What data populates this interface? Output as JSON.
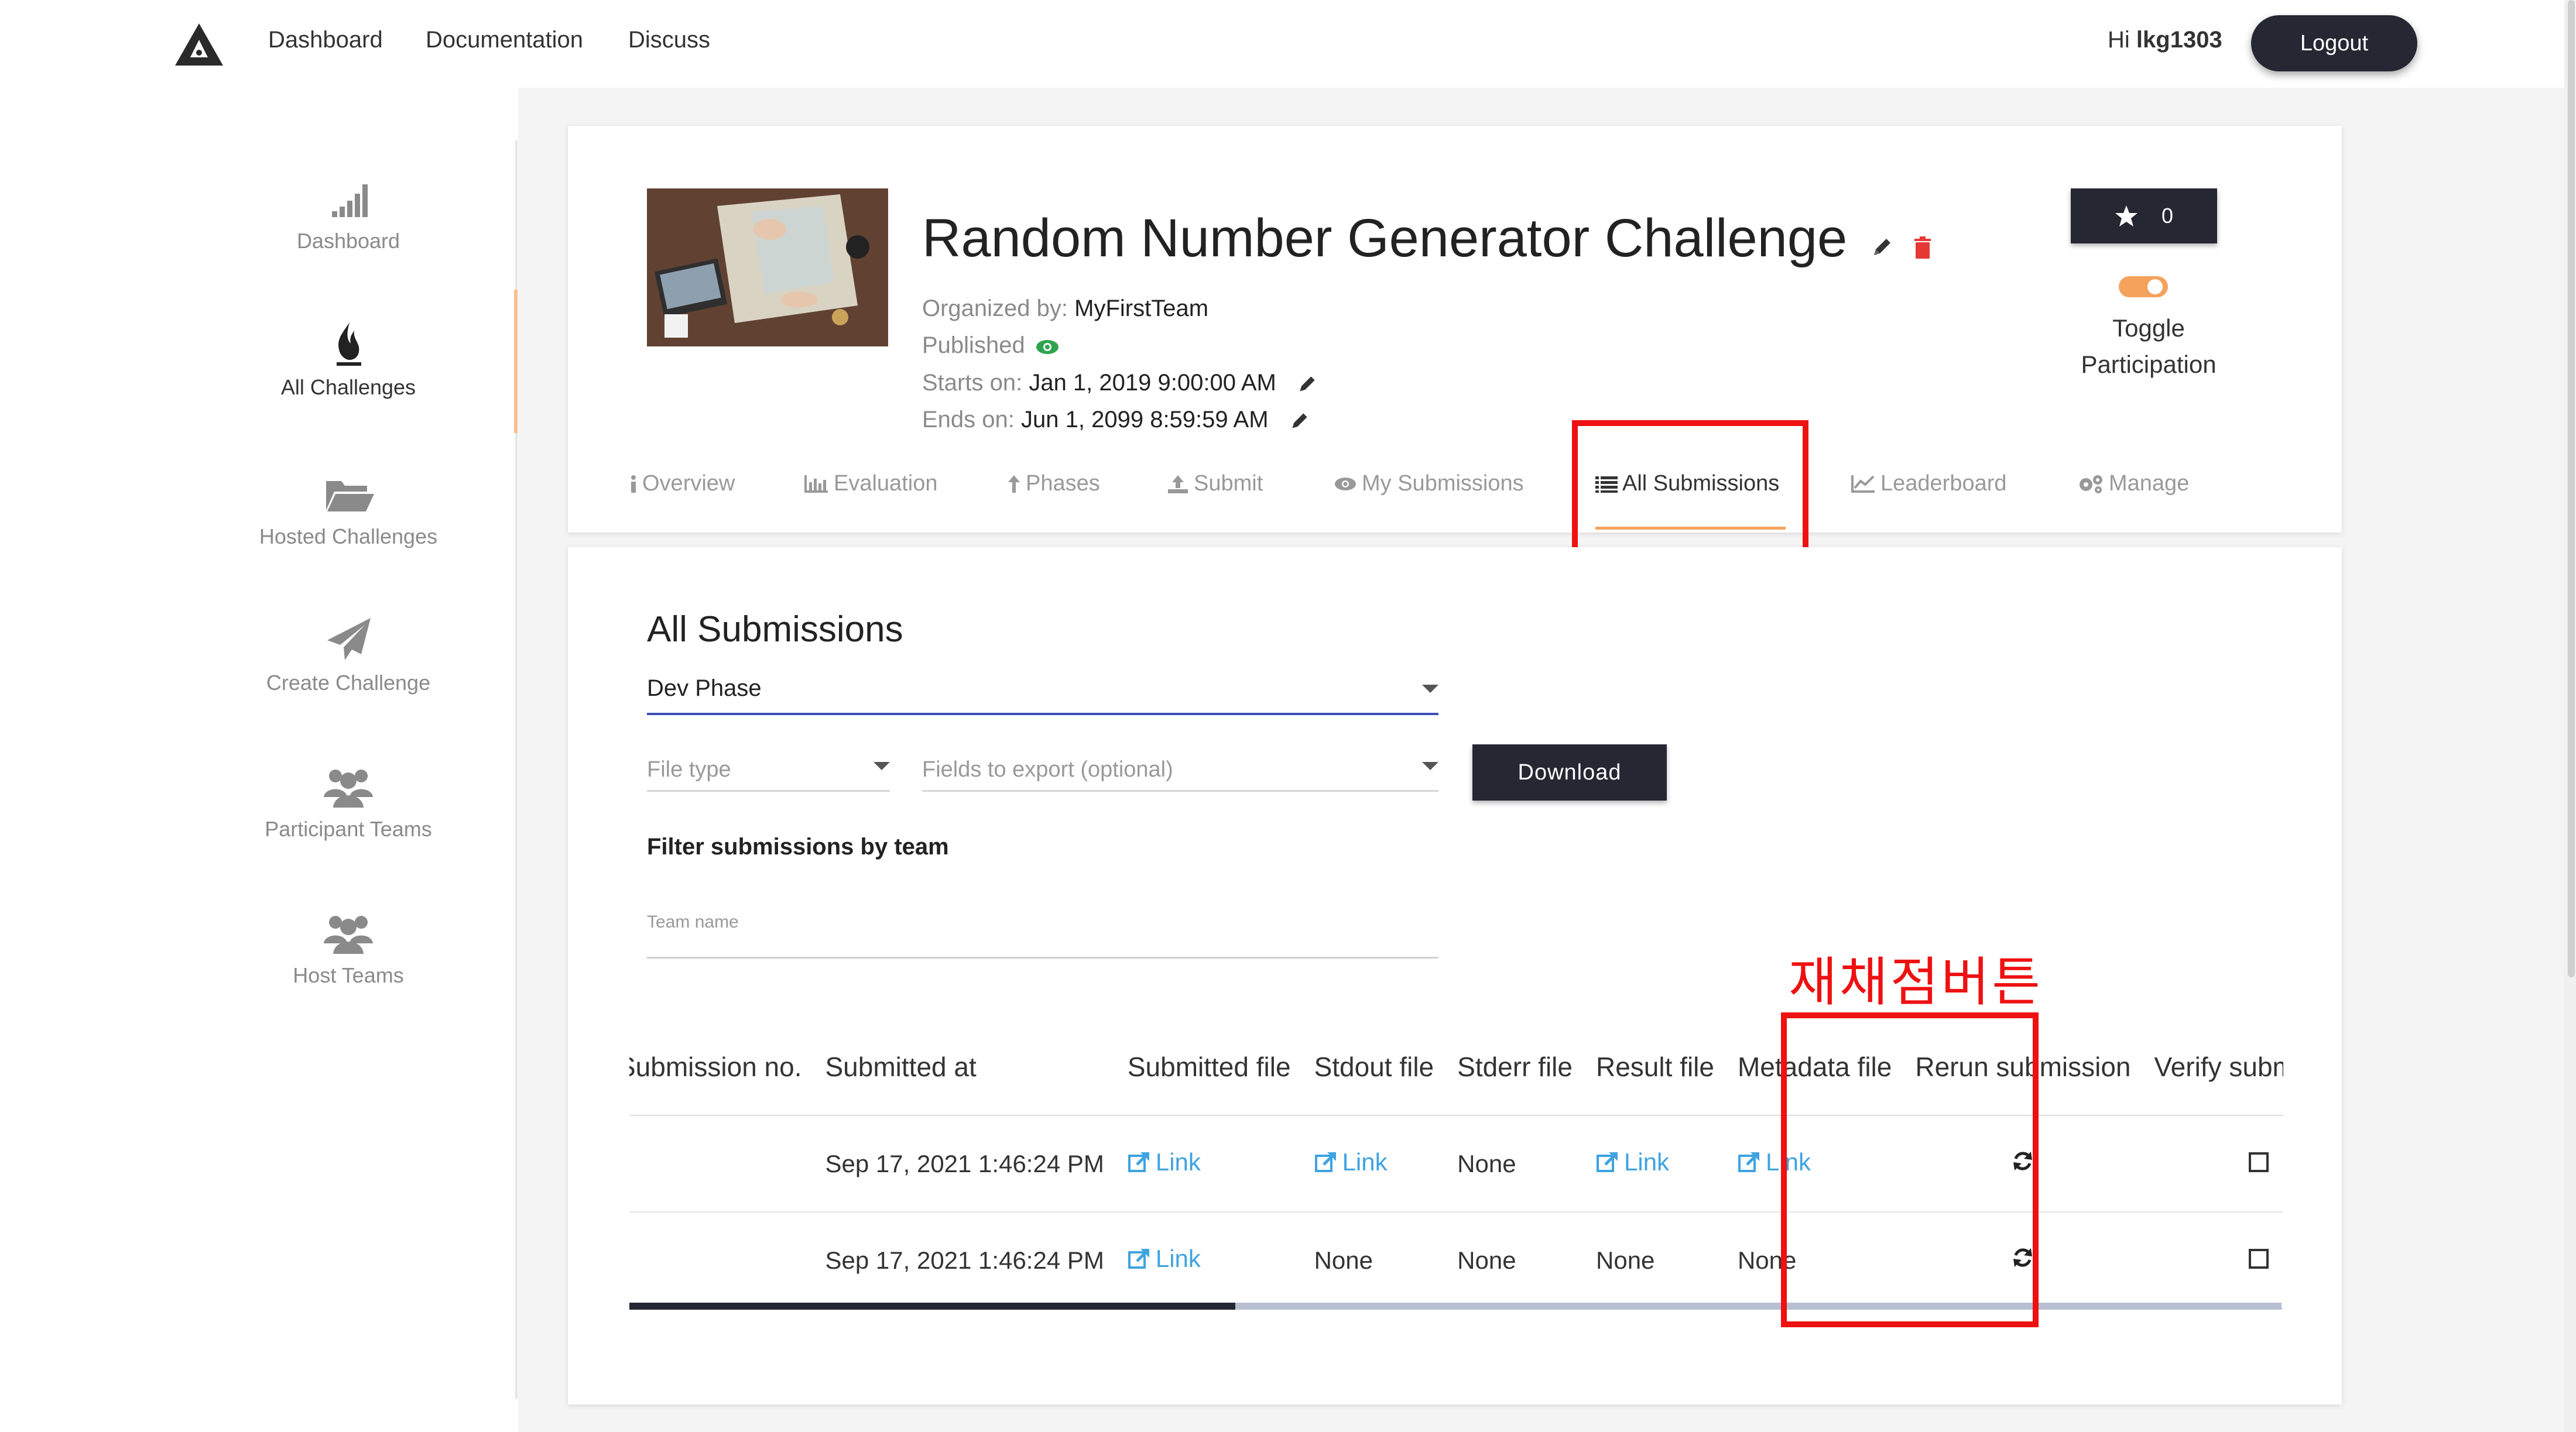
{
  "nav": {
    "links": [
      "Dashboard",
      "Documentation",
      "Discuss"
    ],
    "greeting_prefix": "Hi",
    "username": "lkg1303",
    "logout_label": "Logout"
  },
  "sidebar": {
    "items": [
      {
        "label": "Dashboard",
        "icon": "signal-bars-icon"
      },
      {
        "label": "All Challenges",
        "icon": "flame-icon",
        "active": true
      },
      {
        "label": "Hosted Challenges",
        "icon": "folder-open-icon"
      },
      {
        "label": "Create Challenge",
        "icon": "paper-plane-icon"
      },
      {
        "label": "Participant Teams",
        "icon": "users-icon"
      },
      {
        "label": "Host Teams",
        "icon": "users-icon"
      }
    ]
  },
  "challenge": {
    "title": "Random Number Generator Challenge",
    "organized_by_key": "Organized by:",
    "organized_by": "MyFirstTeam",
    "published": "Published",
    "starts_key": "Starts on:",
    "starts": "Jan 1, 2019 9:00:00 AM",
    "ends_key": "Ends on:",
    "ends": "Jun 1, 2099 8:59:59 AM",
    "star_count": "0",
    "toggle_label": "Toggle Participation"
  },
  "tabs": [
    {
      "label": "Overview",
      "icon": "info-icon"
    },
    {
      "label": "Evaluation",
      "icon": "bar-chart-icon"
    },
    {
      "label": "Phases",
      "icon": "arrow-up-icon"
    },
    {
      "label": "Submit",
      "icon": "upload-icon"
    },
    {
      "label": "My Submissions",
      "icon": "eye-icon"
    },
    {
      "label": "All Submissions",
      "icon": "list-icon",
      "active": true
    },
    {
      "label": "Leaderboard",
      "icon": "line-chart-icon"
    },
    {
      "label": "Manage",
      "icon": "gears-icon"
    }
  ],
  "submissions": {
    "title": "All Submissions",
    "phase": "Dev Phase",
    "file_type_placeholder": "File type",
    "fields_placeholder": "Fields to export (optional)",
    "download_label": "Download",
    "filter_label": "Filter submissions by team",
    "team_placeholder": "Team name",
    "annotation": "재채점버튼",
    "columns": [
      "Submission no.",
      "Submitted at",
      "Submitted file",
      "Stdout file",
      "Stderr file",
      "Result file",
      "Metadata file",
      "Rerun submission",
      "Verify submission"
    ],
    "rows": [
      {
        "submitted_at": "Sep 17, 2021 1:46:24 PM",
        "submitted_file": "Link",
        "stdout": "Link",
        "stderr": "None",
        "result": "Link",
        "metadata": "Link"
      },
      {
        "submitted_at": "Sep 17, 2021 1:46:24 PM",
        "submitted_file": "Link",
        "stdout": "None",
        "stderr": "None",
        "result": "None",
        "metadata": "None"
      }
    ]
  },
  "colors": {
    "dark": "#252833",
    "accent": "#f5a25d",
    "link": "#3fa3e0",
    "annotation": "#ee1111",
    "published": "#2ea44f",
    "delete": "#e53935"
  }
}
